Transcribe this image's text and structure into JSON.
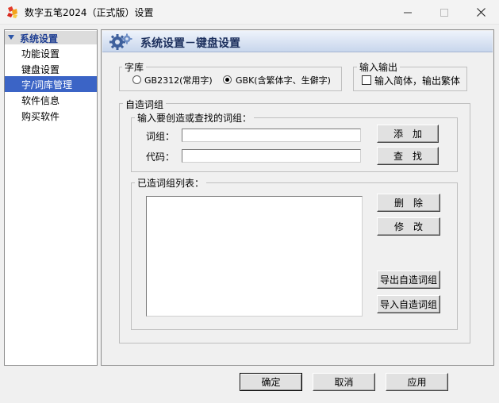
{
  "window": {
    "title": "数字五笔2024（正式版）设置",
    "icon": "app-logo-icon"
  },
  "nav": {
    "header": "系统设置",
    "items": [
      {
        "label": "功能设置",
        "selected": false
      },
      {
        "label": "键盘设置",
        "selected": false
      },
      {
        "label": "字/词库管理",
        "selected": true
      },
      {
        "label": "软件信息",
        "selected": false
      },
      {
        "label": "购买软件",
        "selected": false
      }
    ]
  },
  "panel": {
    "title": "系统设置－键盘设置",
    "charset": {
      "legend": "字库",
      "option_gb": "GB2312(常用字)",
      "option_gbk": "GBK(含繁体字、生僻字)",
      "selected": "GBK"
    },
    "io": {
      "legend": "输入输出",
      "checkbox_label": "输入简体，输出繁体",
      "checked": false
    },
    "custom": {
      "legend": "自造词组",
      "create": {
        "legend": "输入要创造或查找的词组：",
        "word_label": "词组：",
        "word_value": "",
        "code_label": "代码：",
        "code_value": "",
        "add_button": "添加",
        "find_button": "查找"
      },
      "list": {
        "legend": "已造词组列表：",
        "items": [],
        "delete_button": "删除",
        "modify_button": "修改",
        "export_button": "导出自造词组",
        "import_button": "导入自造词组"
      }
    }
  },
  "footer": {
    "ok": "确定",
    "cancel": "取消",
    "apply": "应用"
  },
  "colors": {
    "selection": "#3b64c6",
    "nav_header_text": "#1f3f93",
    "panel_header": "#c8d6ec"
  }
}
